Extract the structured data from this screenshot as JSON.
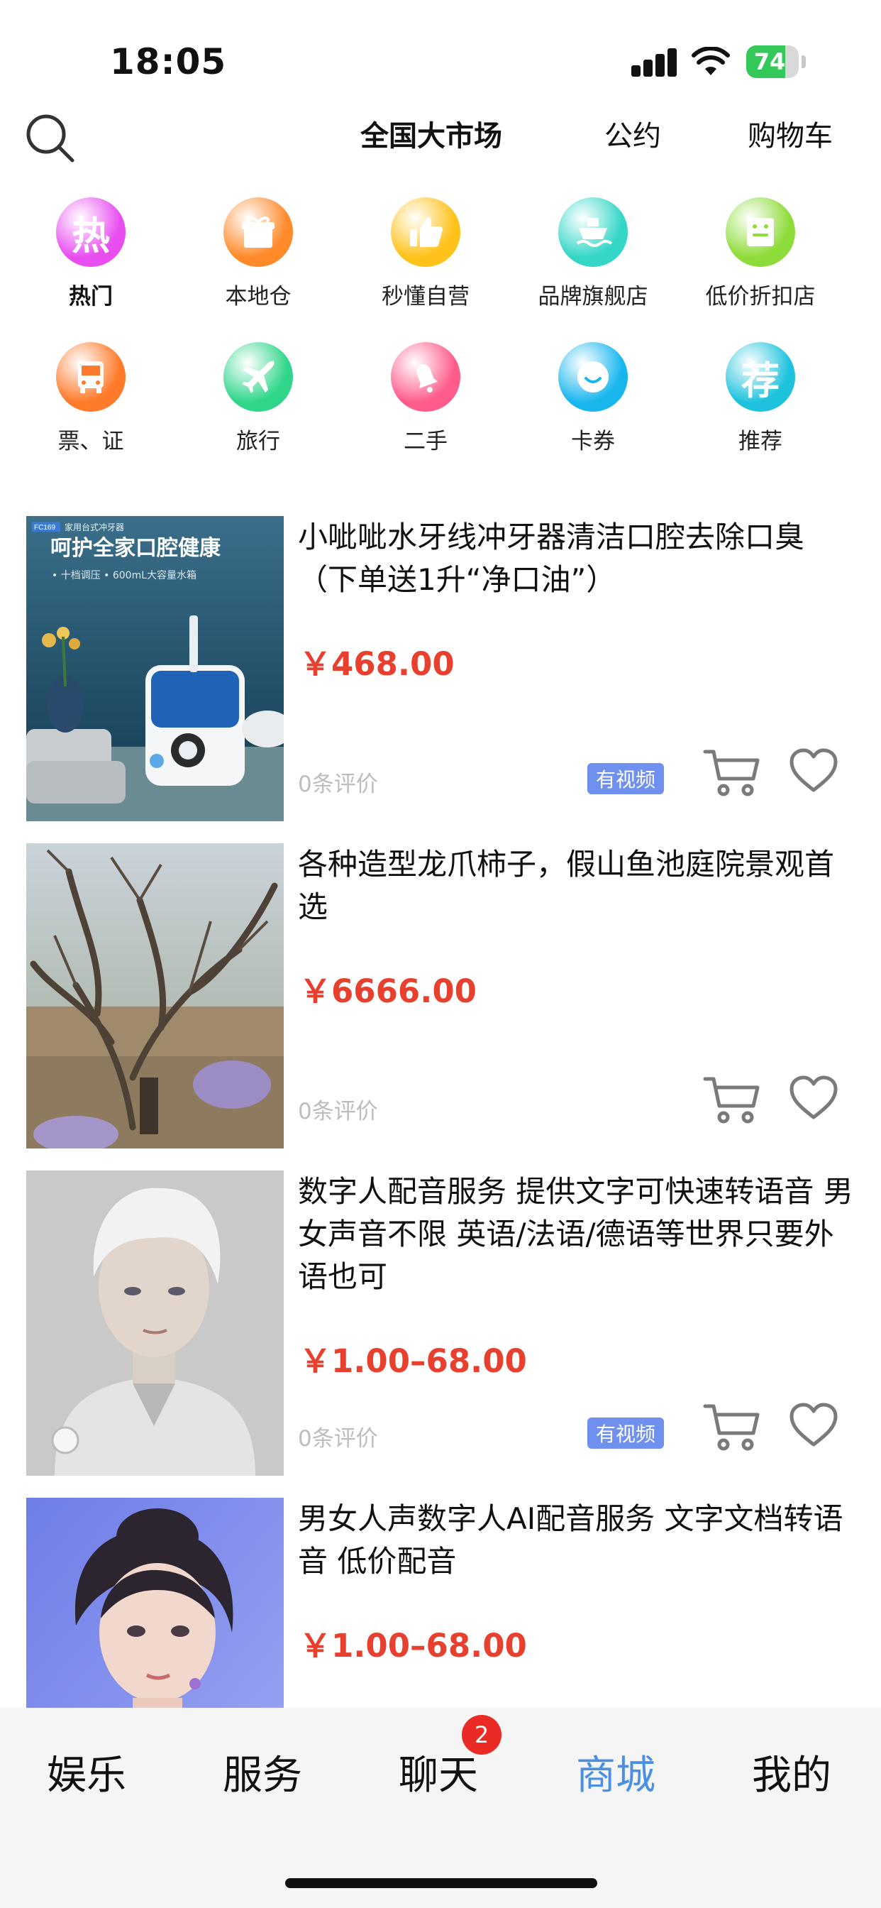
{
  "status_bar": {
    "time": "18:05",
    "battery": "74",
    "battery_level": 0.74
  },
  "top_nav": {
    "tabs": [
      "全国大市场",
      "公约",
      "购物车"
    ]
  },
  "categories": [
    {
      "label": "热门",
      "glyph": "热",
      "color": "#e84df0"
    },
    {
      "label": "本地仓",
      "glyph": "",
      "icon": "gift-icon",
      "color": "#ff8a2a"
    },
    {
      "label": "秒懂自营",
      "glyph": "",
      "icon": "thumbs-up-icon",
      "color": "#ffc21a"
    },
    {
      "label": "品牌旗舰店",
      "glyph": "",
      "icon": "ship-icon",
      "color": "#33d6c7"
    },
    {
      "label": "低价折扣店",
      "glyph": "",
      "icon": "store-icon",
      "color": "#8edc3a"
    },
    {
      "label": "票、证",
      "glyph": "",
      "icon": "bus-icon",
      "color": "#ff7a2a"
    },
    {
      "label": "旅行",
      "glyph": "",
      "icon": "airplane-icon",
      "color": "#2fd68a"
    },
    {
      "label": "二手",
      "glyph": "",
      "icon": "bell-icon",
      "color": "#ff5c8a"
    },
    {
      "label": "卡券",
      "glyph": "",
      "icon": "smile-icon",
      "color": "#19b6ee"
    },
    {
      "label": "推荐",
      "glyph": "荐",
      "color": "#1ec2dd"
    }
  ],
  "products": [
    {
      "title": "小呲呲水牙线冲牙器清洁口腔去除口臭（下单送1升“净口油”）",
      "price": "￥468.00",
      "reviews": "0条评价",
      "video_badge": "有视频",
      "image_text": {
        "model": "FC169",
        "subtitle": "家用台式冲牙器",
        "headline": "呵护全家口腔健康",
        "features": "• 十档调压   • 600mL大容量水箱"
      }
    },
    {
      "title": "各种造型龙爪柿子，假山鱼池庭院景观首选",
      "price": "￥6666.00",
      "reviews": "0条评价",
      "video_badge": ""
    },
    {
      "title": "数字人配音服务 提供文字可快速转语音 男女声音不限 英语/法语/德语等世界只要外语也可",
      "price": "￥1.00–68.00",
      "reviews": "0条评价",
      "video_badge": "有视频"
    },
    {
      "title": "男女人声数字人AI配音服务 文字文档转语音 低价配音",
      "price": "￥1.00–68.00",
      "reviews": "",
      "video_badge": ""
    }
  ],
  "bottom_tabs": [
    "娱乐",
    "服务",
    "聊天",
    "商城",
    "我的"
  ],
  "chat_badge": "2",
  "colors": {
    "accent": "#4a90e2",
    "price": "#e8402f",
    "video_badge": "#6f90ee",
    "badge": "#ea2a24"
  }
}
